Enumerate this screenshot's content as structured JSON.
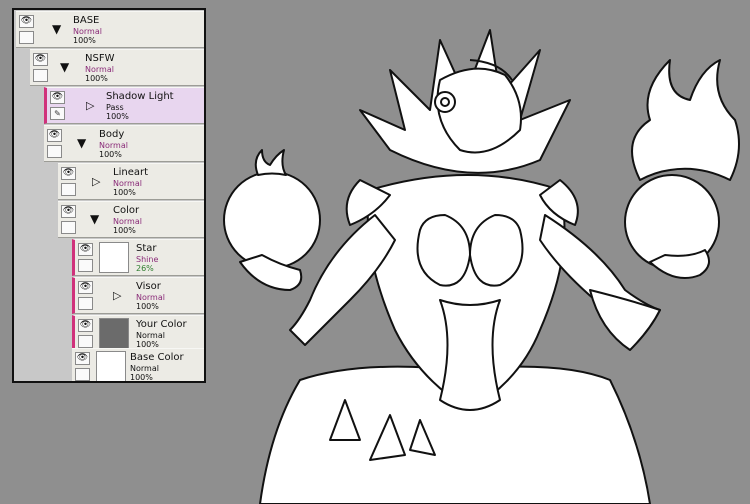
{
  "layers_panel": {
    "layers": [
      {
        "name": "BASE",
        "mode": "Normal",
        "opacity": "100%"
      },
      {
        "name": "NSFW",
        "mode": "Normal",
        "opacity": "100%"
      },
      {
        "name": "Shadow Light",
        "mode": "Pass",
        "opacity": "100%"
      },
      {
        "name": "Body",
        "mode": "Normal",
        "opacity": "100%"
      },
      {
        "name": "Lineart",
        "mode": "Normal",
        "opacity": "100%"
      },
      {
        "name": "Color",
        "mode": "Normal",
        "opacity": "100%"
      },
      {
        "name": "Star",
        "mode": "Shine",
        "opacity": "26%"
      },
      {
        "name": "Visor",
        "mode": "Normal",
        "opacity": "100%"
      },
      {
        "name": "Your Color",
        "mode": "Normal",
        "opacity": "100%"
      },
      {
        "name": "Base Color",
        "mode": "Normal",
        "opacity": "100%"
      }
    ]
  },
  "colors": {
    "canvas_background": "#8f8f8f",
    "selected_layer": "#e8d6ef",
    "accent_pink": "#d0317b",
    "mode_text": "#8a2b78"
  },
  "icons": {
    "visibility": "eye-icon",
    "folder_open": "caret-down-icon",
    "folder_closed": "caret-right-icon",
    "edit": "pencil-icon"
  }
}
